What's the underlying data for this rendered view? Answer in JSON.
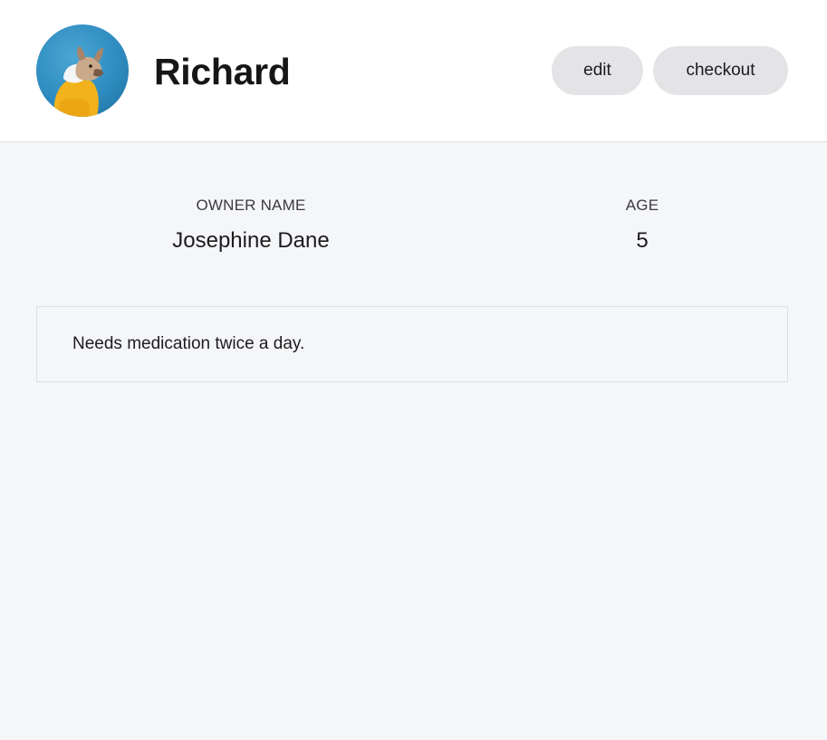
{
  "pet": {
    "name": "Richard",
    "avatar_icon": "dog-photo-avatar"
  },
  "actions": {
    "edit_label": "edit",
    "checkout_label": "checkout"
  },
  "details": {
    "owner_label": "OWNER NAME",
    "owner_value": "Josephine Dane",
    "age_label": "AGE",
    "age_value": "5"
  },
  "notes": {
    "text": "Needs medication twice a day."
  },
  "colors": {
    "page_background": "#f5f6f8",
    "header_background": "#ffffff",
    "button_background": "#e4e4e7",
    "avatar_background": "#2f8cc0"
  }
}
